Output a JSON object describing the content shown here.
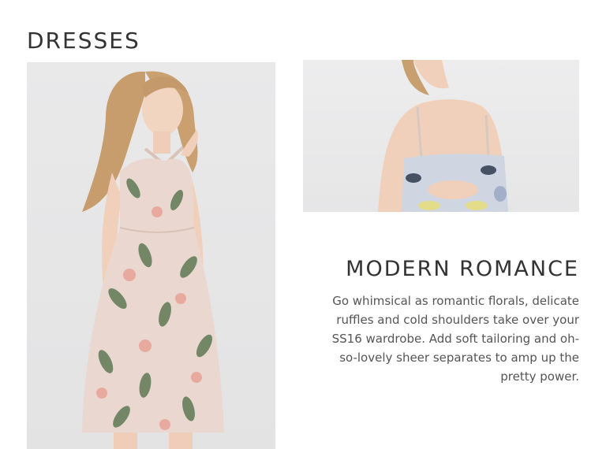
{
  "section": {
    "title": "DRESSES"
  },
  "images": {
    "main": {
      "alt": "Woman in floral halter midi dress"
    },
    "back": {
      "alt": "Back view of floral dress with cut-out"
    }
  },
  "feature": {
    "title": "MODERN ROMANCE",
    "body": "Go whimsical as romantic florals, delicate ruffles and cold shoulders take over your SS16 wardrobe. Add soft tailoring and oh-so-lovely sheer separates to amp up the pretty power."
  },
  "colors": {
    "text_dark": "#333333",
    "text_body": "#555555",
    "photo_bg": "#e8e8e9",
    "dress_base": "#ead7cf",
    "leaf_green": "#5f7a55",
    "flower_pink": "#e8a59a",
    "hair": "#c49a6c",
    "skin": "#f2d5c1"
  }
}
